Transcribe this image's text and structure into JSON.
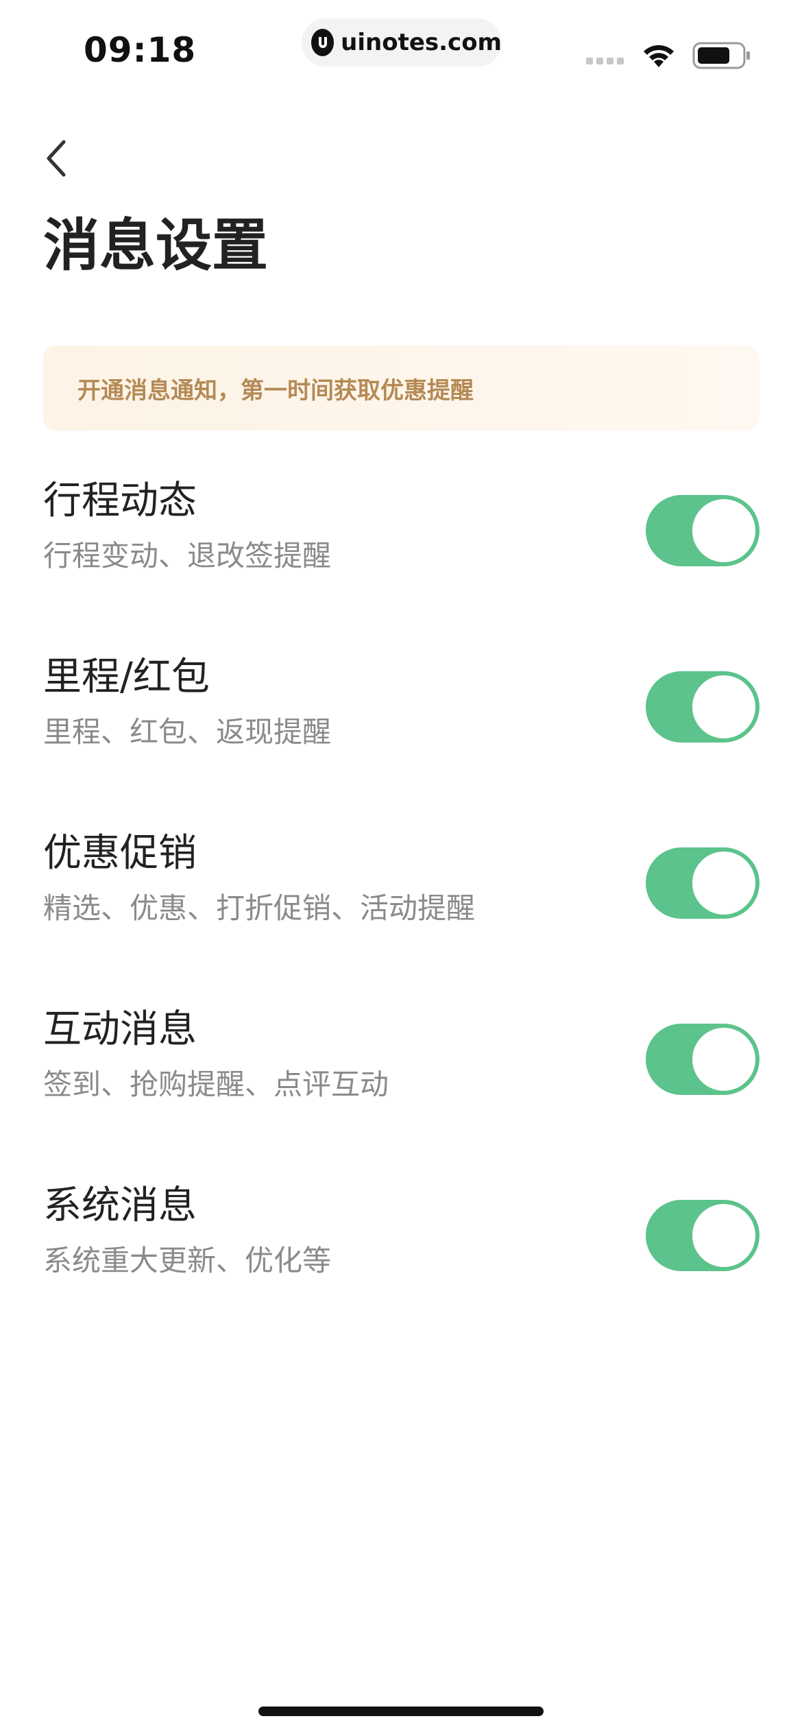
{
  "status_bar": {
    "time": "09:18",
    "url": "uinotes.com",
    "icons": [
      "signal-icon",
      "wifi-icon",
      "battery-icon"
    ]
  },
  "nav": {
    "back_icon": "chevron-left-icon",
    "title": "消息设置"
  },
  "notice": {
    "text": "开通消息通知，第一时间获取优惠提醒"
  },
  "settings": [
    {
      "title": "行程动态",
      "desc": "行程变动、退改签提醒",
      "enabled": true
    },
    {
      "title": "里程/红包",
      "desc": "里程、红包、返现提醒",
      "enabled": true
    },
    {
      "title": "优惠促销",
      "desc": "精选、优惠、打折促销、活动提醒",
      "enabled": true
    },
    {
      "title": "互动消息",
      "desc": "签到、抢购提醒、点评互动",
      "enabled": true
    },
    {
      "title": "系统消息",
      "desc": "系统重大更新、优化等",
      "enabled": true
    }
  ],
  "colors": {
    "toggle_on": "#5bc38b",
    "notice_text": "#b48a55",
    "notice_bg": "#fdf3e6"
  }
}
